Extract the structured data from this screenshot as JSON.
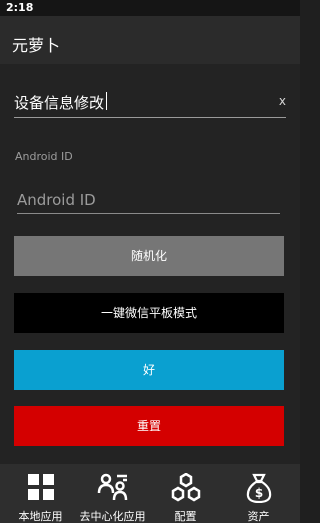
{
  "statusbar": {
    "time": "2:18"
  },
  "appbar": {
    "title": "元萝卜"
  },
  "search": {
    "value": "设备信息修改",
    "clear_label": "x"
  },
  "android_id": {
    "label": "Android ID",
    "placeholder": "Android ID",
    "value": ""
  },
  "buttons": {
    "randomize": "随机化",
    "wechat_tablet_mode": "一键微信平板模式",
    "ok": "好",
    "reset": "重置"
  },
  "bottom_nav": {
    "items": [
      {
        "label": "本地应用",
        "icon": "grid-icon"
      },
      {
        "label": "去中心化应用",
        "icon": "users-icon"
      },
      {
        "label": "配置",
        "icon": "hexagons-icon"
      },
      {
        "label": "资产",
        "icon": "money-bag-icon"
      }
    ]
  },
  "colors": {
    "background": "#232323",
    "randomize_button": "#767676",
    "wechat_button": "#000000",
    "ok_button": "#0aa0d0",
    "reset_button": "#d40000"
  }
}
